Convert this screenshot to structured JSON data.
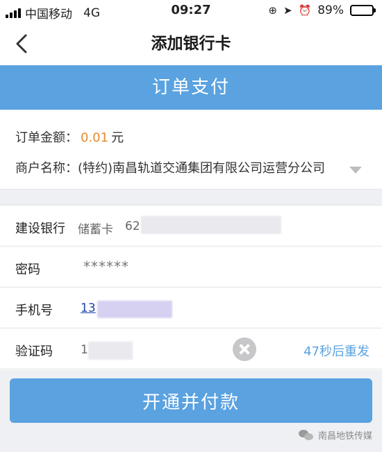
{
  "status_bar": {
    "carrier": "中国移动",
    "network": "4G",
    "time": "09:27",
    "battery_percent": "89%",
    "battery_level": 0.89
  },
  "nav": {
    "title": "添加银行卡"
  },
  "order": {
    "header_title": "订单支付",
    "amount_label": "订单金额：",
    "amount_value": "0.01",
    "amount_unit": "元",
    "merchant_label": "商户名称：",
    "merchant_value": "(特约)南昌轨道交通集团有限公司运营分公司"
  },
  "form": {
    "bank": {
      "label": "建设银行",
      "card_type": "储蓄卡",
      "card_prefix": "62"
    },
    "password": {
      "label": "密码",
      "value": "******"
    },
    "phone": {
      "label": "手机号",
      "value_visible": "13"
    },
    "code": {
      "label": "验证码",
      "value_visible": "1",
      "resend": "47秒后重发"
    }
  },
  "actions": {
    "pay_label": "开通并付款"
  },
  "watermark": {
    "text": "南昌地铁传媒"
  },
  "colors": {
    "accent": "#5aa2e0",
    "amount": "#e8892f",
    "link": "#1f3fa8"
  }
}
